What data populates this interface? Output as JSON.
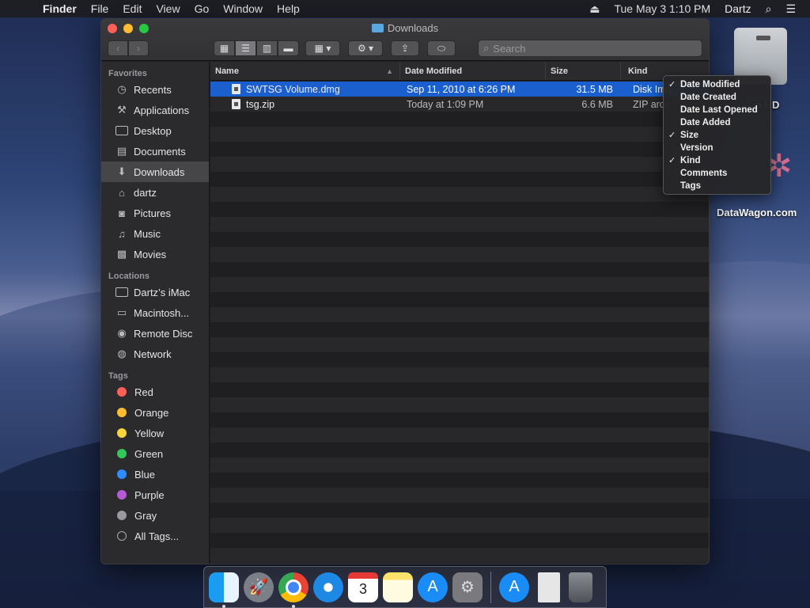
{
  "menubar": {
    "app_name": "Finder",
    "items": [
      "File",
      "Edit",
      "View",
      "Go",
      "Window",
      "Help"
    ],
    "clock": "Tue May 3  1:10 PM",
    "user": "Dartz"
  },
  "window": {
    "title": "Downloads",
    "search_placeholder": "Search"
  },
  "sidebar": {
    "favorites_label": "Favorites",
    "favorites": [
      "Recents",
      "Applications",
      "Desktop",
      "Documents",
      "Downloads",
      "dartz",
      "Pictures",
      "Music",
      "Movies"
    ],
    "locations_label": "Locations",
    "locations": [
      "Dartz’s iMac",
      "Macintosh...",
      "Remote Disc",
      "Network"
    ],
    "tags_label": "Tags",
    "tags": [
      {
        "name": "Red",
        "color": "#fe5f57"
      },
      {
        "name": "Orange",
        "color": "#febc2e"
      },
      {
        "name": "Yellow",
        "color": "#f7d53b"
      },
      {
        "name": "Green",
        "color": "#34c759"
      },
      {
        "name": "Blue",
        "color": "#2f8cff"
      },
      {
        "name": "Purple",
        "color": "#b65ad6"
      },
      {
        "name": "Gray",
        "color": "#9a9a9e"
      },
      {
        "name": "All Tags...",
        "color": ""
      }
    ]
  },
  "columns": {
    "name": "Name",
    "date_modified": "Date Modified",
    "size": "Size",
    "kind": "Kind"
  },
  "files": [
    {
      "name": "SWTSG Volume.dmg",
      "date": "Sep 11, 2010 at 6:26 PM",
      "size": "31.5 MB",
      "kind": "Disk Ima"
    },
    {
      "name": "tsg.zip",
      "date": "Today at 1:09 PM",
      "size": "6.6 MB",
      "kind": "ZIP arch"
    }
  ],
  "context_menu": {
    "items": [
      {
        "label": "Date Modified",
        "checked": true
      },
      {
        "label": "Date Created",
        "checked": false
      },
      {
        "label": "Date Last Opened",
        "checked": false
      },
      {
        "label": "Date Added",
        "checked": false
      },
      {
        "label": "Size",
        "checked": true
      },
      {
        "label": "Version",
        "checked": false
      },
      {
        "label": "Kind",
        "checked": true
      },
      {
        "label": "Comments",
        "checked": false
      },
      {
        "label": "Tags",
        "checked": false
      }
    ]
  },
  "desktop": {
    "hd_label": "n HD",
    "site_label": "DataWagon.com"
  },
  "dock": {
    "calendar_month": "MAY",
    "calendar_day": "3"
  }
}
